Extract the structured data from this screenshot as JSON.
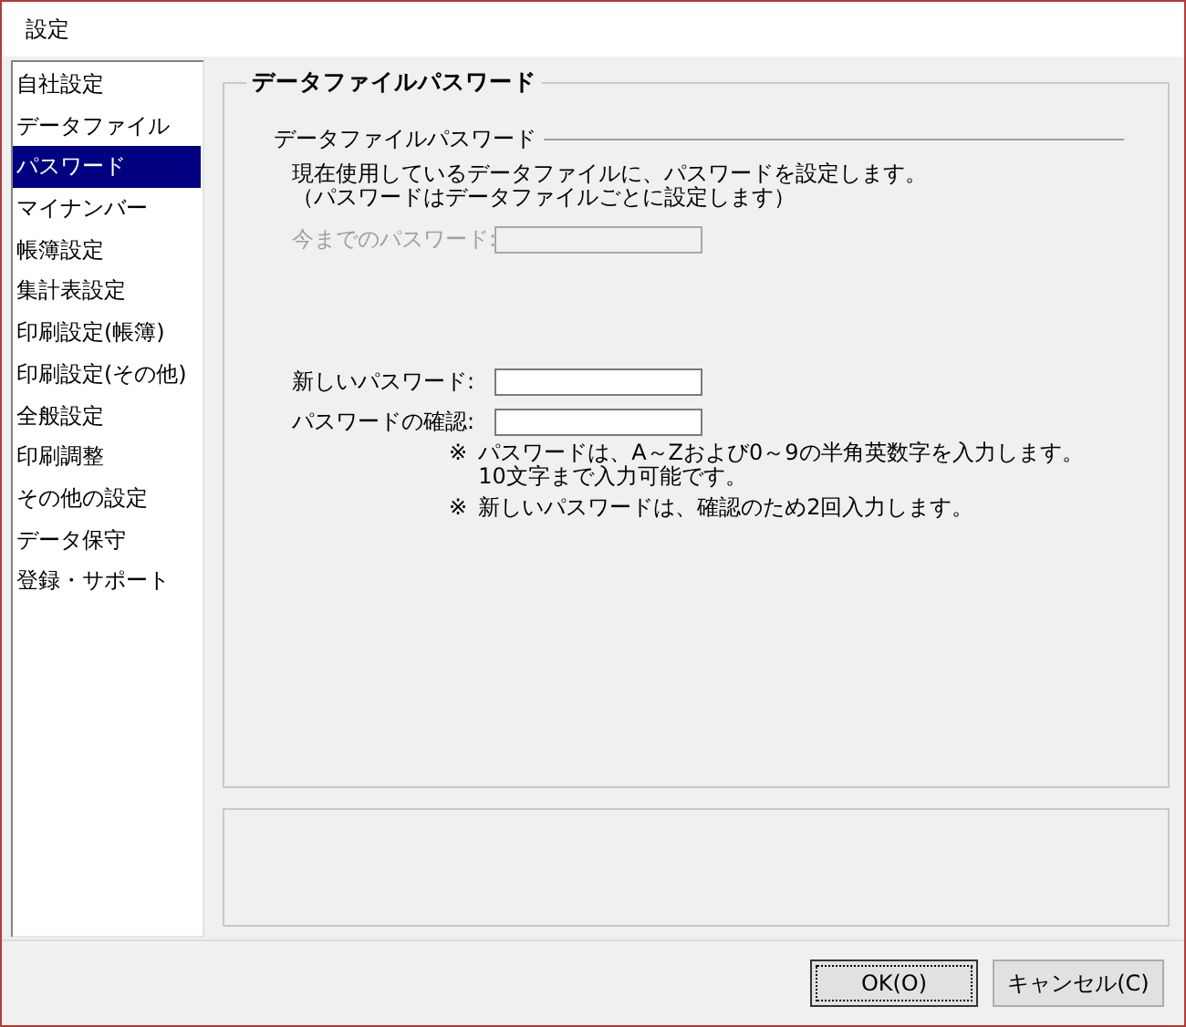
{
  "window": {
    "title": "設定"
  },
  "sidebar": {
    "items": [
      {
        "label": "自社設定",
        "selected": false
      },
      {
        "label": "データファイル",
        "selected": false
      },
      {
        "label": "パスワード",
        "selected": true
      },
      {
        "label": "マイナンバー",
        "selected": false
      },
      {
        "label": "帳簿設定",
        "selected": false
      },
      {
        "label": "集計表設定",
        "selected": false
      },
      {
        "label": "印刷設定(帳簿)",
        "selected": false
      },
      {
        "label": "印刷設定(その他)",
        "selected": false
      },
      {
        "label": "全般設定",
        "selected": false
      },
      {
        "label": "印刷調整",
        "selected": false
      },
      {
        "label": "その他の設定",
        "selected": false
      },
      {
        "label": "データ保守",
        "selected": false
      },
      {
        "label": "登録・サポート",
        "selected": false
      }
    ]
  },
  "group": {
    "title": "データファイルパスワード",
    "subgroup_title": "データファイルパスワード",
    "description": [
      "現在使用しているデータファイルに、パスワードを設定します。",
      "（パスワードはデータファイルごとに設定します）"
    ],
    "fields": [
      {
        "label": "今までのパスワード:",
        "disabled": true
      },
      {
        "label": "新しいパスワード:",
        "disabled": false
      },
      {
        "label": "パスワードの確認:",
        "disabled": false
      }
    ],
    "notes": [
      {
        "mark": "※",
        "lines": [
          "パスワードは、A～Zおよび0～9の半角英数字を入力します。",
          "10文字まで入力可能です。"
        ]
      },
      {
        "mark": "※",
        "lines": [
          "新しいパスワードは、確認のため2回入力します。"
        ]
      }
    ]
  },
  "buttons": [
    {
      "label": "OK(O)",
      "focused": true
    },
    {
      "label": "キャンセル(C)",
      "focused": false
    }
  ]
}
